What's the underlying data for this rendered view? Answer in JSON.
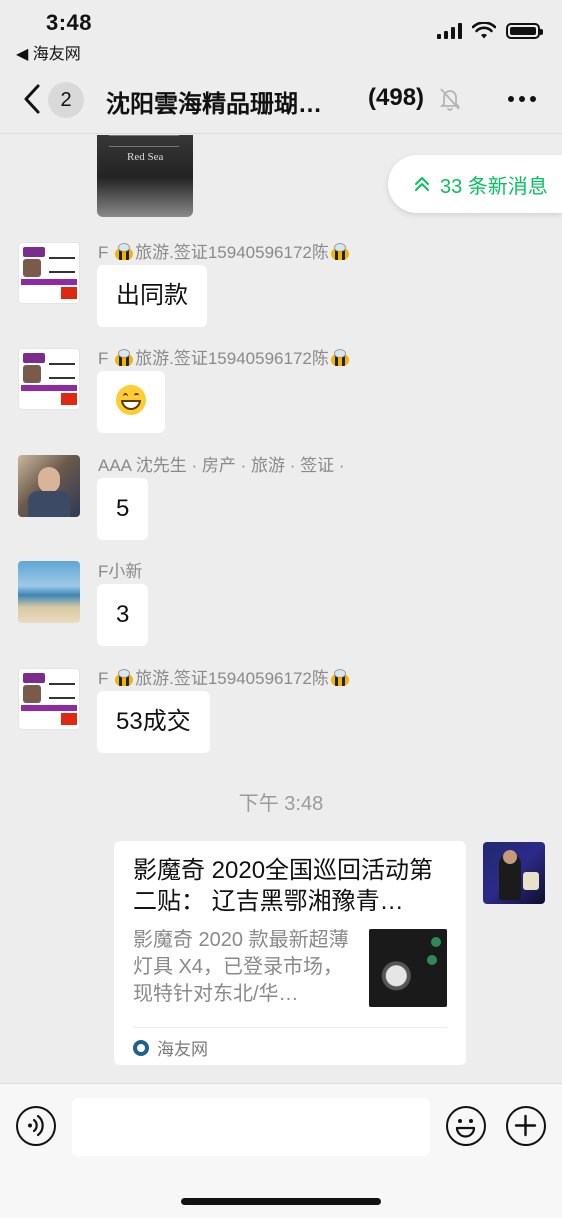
{
  "status_bar": {
    "time": "3:48",
    "back_app": "◀ 海友网"
  },
  "nav": {
    "unread_count": "2",
    "title": "沈阳雲海精品珊瑚…",
    "member_count": "(498)"
  },
  "new_messages": {
    "label": "33 条新消息"
  },
  "image_message": {
    "brand_text": "Red Sea"
  },
  "messages": [
    {
      "sender_prefix": "F",
      "sender_middle": "旅游.签证15940596172陈",
      "text": "出同款",
      "avatar": "card"
    },
    {
      "sender_prefix": "F",
      "sender_middle": "旅游.签证15940596172陈",
      "text": "",
      "emoji": "grinning-face",
      "avatar": "card"
    },
    {
      "sender_name": "AAA 沈先生 · 房产 · 旅游 · 签证 ·",
      "text": "5",
      "avatar": "photo"
    },
    {
      "sender_name": "F小新",
      "text": "3",
      "avatar": "sea"
    },
    {
      "sender_prefix": "F",
      "sender_middle": "旅游.签证15940596172陈",
      "text": "53成交",
      "avatar": "card"
    }
  ],
  "timestamp": "下午 3:48",
  "link_card": {
    "title": "影魔奇 2020全国巡回活动第二贴： 辽吉黑鄂湘豫青…",
    "description": "影魔奇 2020 款最新超薄灯具 X4，已登录市场，现特针对东北/华…",
    "source": "海友网"
  },
  "input": {
    "value": "",
    "placeholder": ""
  },
  "colors": {
    "accent": "#07c160",
    "background": "#ededed",
    "bubble": "#ffffff"
  },
  "icons": [
    "back-chevron-icon",
    "mute-bell-icon",
    "more-icon",
    "double-chevron-up-icon",
    "bee-emoji-icon",
    "grinning-face-emoji-icon",
    "voice-icon",
    "emoji-icon",
    "plus-icon"
  ]
}
